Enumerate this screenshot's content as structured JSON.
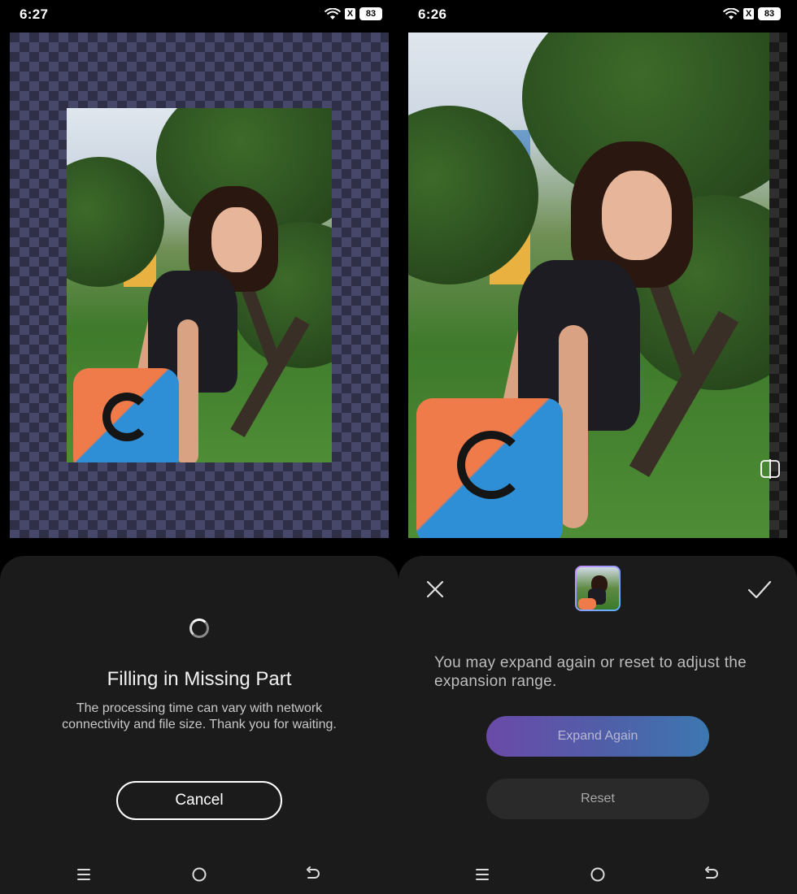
{
  "left_screen": {
    "status": {
      "time": "6:27",
      "sim_label": "X",
      "battery": "83"
    },
    "sheet": {
      "title": "Filling in Missing Part",
      "description": "The processing time can vary with network connectivity and file size. Thank you for waiting.",
      "cancel_label": "Cancel"
    }
  },
  "right_screen": {
    "status": {
      "time": "6:26",
      "sim_label": "X",
      "battery": "83"
    },
    "sheet": {
      "info_text": "You may expand again or reset to adjust the expansion range.",
      "expand_again_label": "Expand Again",
      "reset_label": "Reset"
    }
  },
  "icons": {
    "close": "close-icon",
    "confirm": "check-icon",
    "compare": "compare-icon",
    "spinner": "loading-spinner-icon",
    "nav_menu": "menu-icon",
    "nav_home": "home-icon",
    "nav_back": "back-icon"
  },
  "colors": {
    "background": "#000000",
    "sheet": "#1b1b1b",
    "checker_dark": "#2f2f48",
    "checker_light": "#47476a",
    "expand_gradient_start": "#6a4aa8",
    "expand_gradient_end": "#3c78b0",
    "reset_button": "#2a2a2a"
  }
}
